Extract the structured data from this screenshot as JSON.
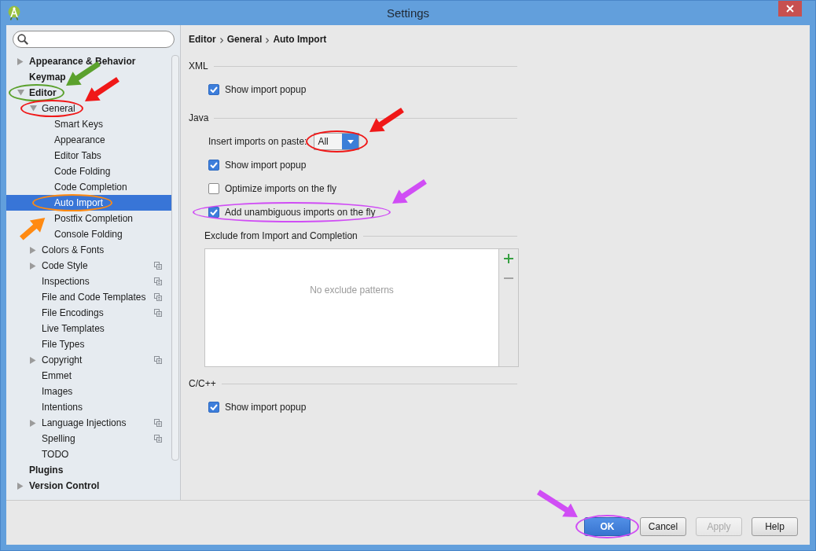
{
  "window": {
    "title": "Settings"
  },
  "sidebar": {
    "tree": [
      {
        "label": "Appearance & Behavior",
        "expanded": false,
        "selected": false
      },
      {
        "label": "Keymap",
        "selected": false
      },
      {
        "label": "Editor",
        "expanded": true,
        "selected": false,
        "annotation": {
          "kind": "northeast",
          "color": "#5ba12d"
        },
        "children": [
          {
            "label": "General",
            "expanded": true,
            "selected": false,
            "per_project": false,
            "annotation": {
              "kind": "northeast",
              "color": "#f01818"
            },
            "children": [
              {
                "label": "Smart Keys",
                "selected": false
              },
              {
                "label": "Appearance",
                "selected": false
              },
              {
                "label": "Editor Tabs",
                "selected": false
              },
              {
                "label": "Code Folding",
                "selected": false
              },
              {
                "label": "Code Completion",
                "selected": false
              },
              {
                "label": "Auto Import",
                "selected": true,
                "annotation": {
                  "kind": "southwest",
                  "color": "#ff8a12"
                }
              },
              {
                "label": "Postfix Completion",
                "selected": false
              },
              {
                "label": "Console Folding",
                "selected": false
              }
            ]
          },
          {
            "label": "Colors & Fonts",
            "expanded": false,
            "selected": false,
            "per_project": false
          },
          {
            "label": "Code Style",
            "expanded": false,
            "selected": false,
            "per_project": true
          },
          {
            "label": "Inspections",
            "selected": false,
            "per_project": true
          },
          {
            "label": "File and Code Templates",
            "selected": false,
            "per_project": true
          },
          {
            "label": "File Encodings",
            "selected": false,
            "per_project": true
          },
          {
            "label": "Live Templates",
            "selected": false,
            "per_project": false
          },
          {
            "label": "File Types",
            "selected": false,
            "per_project": false
          },
          {
            "label": "Copyright",
            "expanded": false,
            "selected": false,
            "per_project": true
          },
          {
            "label": "Emmet",
            "selected": false,
            "per_project": false
          },
          {
            "label": "Images",
            "selected": false,
            "per_project": false
          },
          {
            "label": "Intentions",
            "selected": false,
            "per_project": false
          },
          {
            "label": "Language Injections",
            "expanded": false,
            "selected": false,
            "per_project": true
          },
          {
            "label": "Spelling",
            "selected": false,
            "per_project": true
          },
          {
            "label": "TODO",
            "selected": false,
            "per_project": false
          }
        ]
      },
      {
        "label": "Plugins",
        "selected": false
      },
      {
        "label": "Version Control",
        "expanded": false,
        "selected": false
      }
    ]
  },
  "content": {
    "breadcrumb": [
      "Editor",
      "General",
      "Auto Import"
    ],
    "sections": [
      {
        "title": "XML",
        "options": [
          {
            "kind": "checkbox",
            "label": "Show import popup",
            "checked": true
          }
        ]
      },
      {
        "title": "Java",
        "options": [
          {
            "kind": "dropdown",
            "label": "Insert imports on paste:",
            "value": "All",
            "annotation": {
              "kind": "northeast",
              "color": "#f01818"
            }
          },
          {
            "kind": "checkbox",
            "label": "Show import popup",
            "checked": true
          },
          {
            "kind": "checkbox",
            "label": "Optimize imports on the fly",
            "checked": false
          },
          {
            "kind": "checkbox",
            "label": "Add unambiguous imports on the fly",
            "checked": true,
            "annotation": {
              "kind": "northeast",
              "color": "#d04df5"
            }
          },
          {
            "kind": "list",
            "title": "Exclude from Import and Completion",
            "empty_text": "No exclude patterns",
            "toolbar": [
              {
                "kind": "add",
                "disabled": false
              },
              {
                "kind": "remove",
                "disabled": true
              }
            ]
          }
        ]
      },
      {
        "title": "C/C++",
        "options": [
          {
            "kind": "checkbox",
            "label": "Show import popup",
            "checked": true
          }
        ]
      }
    ]
  },
  "buttons": [
    {
      "label": "OK",
      "default": true,
      "disabled": false,
      "annotation": {
        "kind": "northwest",
        "color": "#d04df5"
      }
    },
    {
      "label": "Cancel",
      "default": false,
      "disabled": false
    },
    {
      "label": "Apply",
      "default": false,
      "disabled": true
    },
    {
      "label": "Help",
      "default": false,
      "disabled": false
    }
  ]
}
